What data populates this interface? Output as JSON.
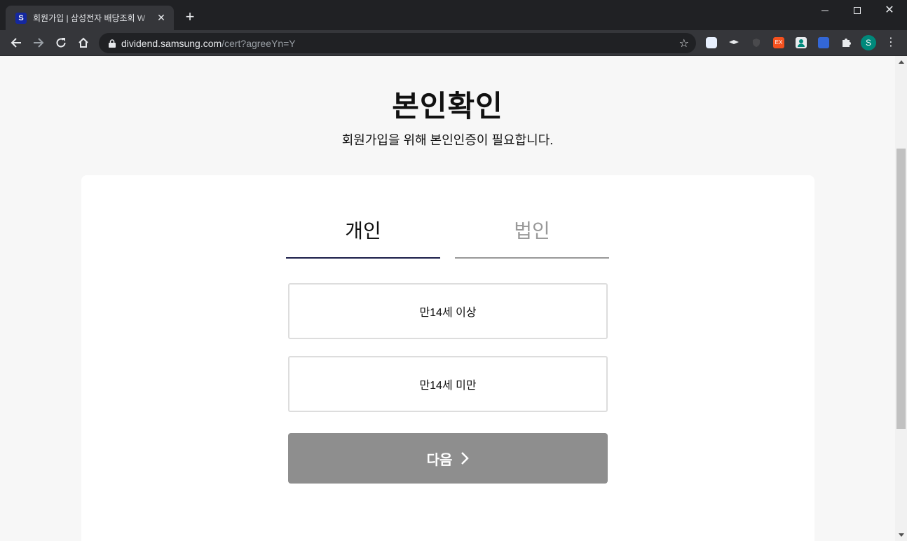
{
  "browser": {
    "tab_title": "회원가입 | 삼성전자 배당조회 W",
    "tab_favicon": "S",
    "tab_close": "✕",
    "new_tab": "+",
    "url_host": "dividend.samsung.com",
    "url_path": "/cert?agreeYn=Y",
    "profile_initial": "S"
  },
  "page": {
    "title": "본인확인",
    "subtitle": "회원가입을 위해 본인인증이 필요합니다."
  },
  "tabs": [
    {
      "label": "개인",
      "active": true
    },
    {
      "label": "법인",
      "active": false
    }
  ],
  "options": {
    "over14": "만14세 이상",
    "under14": "만14세 미만"
  },
  "next_button": {
    "label": "다음"
  },
  "colors": {
    "active_tab_underline": "#1b1f4a",
    "next_button_bg": "#8e8e8e",
    "page_bg": "#f7f7f7"
  }
}
